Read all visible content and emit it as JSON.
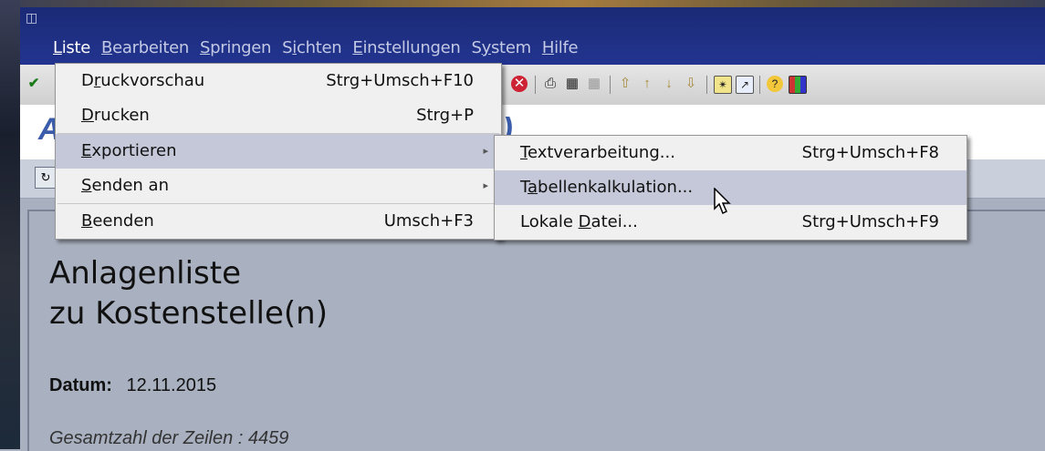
{
  "menubar": {
    "items": [
      {
        "label_pre": "",
        "label_u": "L",
        "label_post": "iste",
        "active": true
      },
      {
        "label_pre": "",
        "label_u": "B",
        "label_post": "earbeiten",
        "active": false
      },
      {
        "label_pre": "",
        "label_u": "S",
        "label_post": "pringen",
        "active": false
      },
      {
        "label_pre": "S",
        "label_u": "i",
        "label_post": "chten",
        "active": false
      },
      {
        "label_pre": "",
        "label_u": "E",
        "label_post": "instellungen",
        "active": false
      },
      {
        "label_pre": "S",
        "label_u": "y",
        "label_post": "stem",
        "active": false
      },
      {
        "label_pre": "",
        "label_u": "H",
        "label_post": "ilfe",
        "active": false
      }
    ]
  },
  "liste_menu": {
    "items": [
      {
        "pre": "D",
        "u": "r",
        "post": "uckvorschau",
        "shortcut": "Strg+Umsch+F10",
        "submenu": false
      },
      {
        "pre": "",
        "u": "D",
        "post": "rucken",
        "shortcut": "Strg+P",
        "submenu": false
      },
      {
        "pre": "",
        "u": "E",
        "post": "xportieren",
        "shortcut": "",
        "submenu": true
      },
      {
        "pre": "",
        "u": "S",
        "post": "enden an",
        "shortcut": "",
        "submenu": true
      },
      {
        "pre": "",
        "u": "B",
        "post": "eenden",
        "shortcut": "Umsch+F3",
        "submenu": false
      }
    ]
  },
  "export_menu": {
    "items": [
      {
        "pre": "",
        "u": "T",
        "post": "extverarbeitung...",
        "shortcut": "Strg+Umsch+F8"
      },
      {
        "pre": "T",
        "u": "a",
        "post": "bellenkalkulation...",
        "shortcut": ""
      },
      {
        "pre": "Lokale ",
        "u": "D",
        "post": "atei...",
        "shortcut": "Strg+Umsch+F9"
      }
    ]
  },
  "header": {
    "title_visible_start": "A",
    "title_visible_end": "nne)"
  },
  "report": {
    "title_line1": "Anlagenliste",
    "title_line2": "zu Kostenstelle(n)",
    "date_label": "Datum:",
    "date_value": "12.11.2015",
    "rows_text": "Gesamtzahl der Zeilen : 4459"
  },
  "colors": {
    "menubar_bg": "#22348f",
    "menu_highlight": "#c4c8d8",
    "content_bg": "#a9b1c0"
  }
}
